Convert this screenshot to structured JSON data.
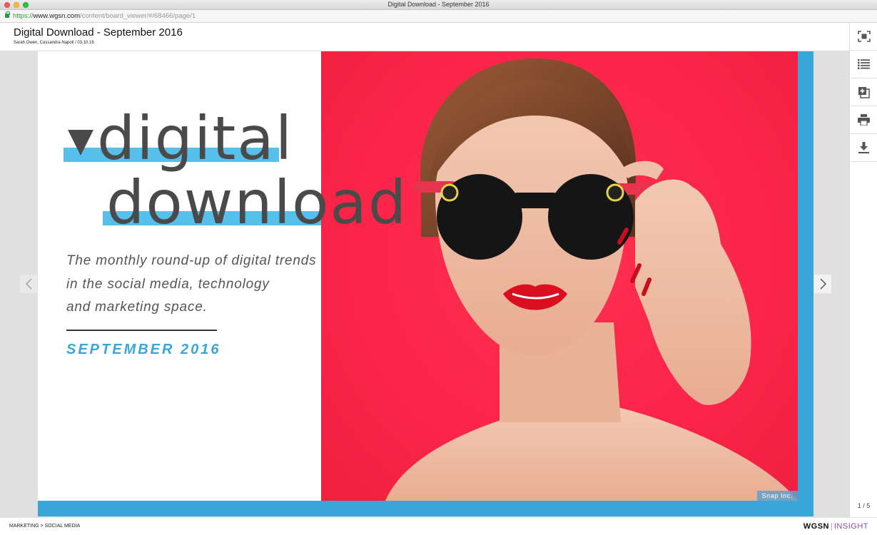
{
  "window": {
    "title": "Digital Download - September 2016"
  },
  "address_bar": {
    "scheme": "https://",
    "host": "www.wgsn.com",
    "path": "/content/board_viewer/#/68466/page/1"
  },
  "document": {
    "title": "Digital Download - September 2016",
    "meta": "Sarah Owen, Cassandra Napoli / 03.10.16"
  },
  "toolbar": {
    "items": [
      {
        "name": "fullscreen",
        "icon": "fullscreen-icon"
      },
      {
        "name": "contents",
        "icon": "list-icon"
      },
      {
        "name": "add-to-board",
        "icon": "add-to-board-icon"
      },
      {
        "name": "print",
        "icon": "print-icon"
      },
      {
        "name": "download",
        "icon": "download-icon"
      }
    ],
    "page_indicator": "1 / 5"
  },
  "slide": {
    "title_line1": "digital",
    "title_line2": "download",
    "tagline_lines": [
      "The monthly round-up of digital trends",
      "in the social media, technology",
      "and marketing space."
    ],
    "date": "SEPTEMBER 2016",
    "photo_credit": "Snap Inc.",
    "colors": {
      "accent_blue": "#3aa6d8",
      "highlight_blue": "#56bfea",
      "photo_bg": "#fb2549"
    }
  },
  "footer": {
    "breadcrumb": "MARKETING > SOCIAL MEDIA",
    "brand_primary": "WGSN",
    "brand_secondary": "INSIGHT"
  }
}
